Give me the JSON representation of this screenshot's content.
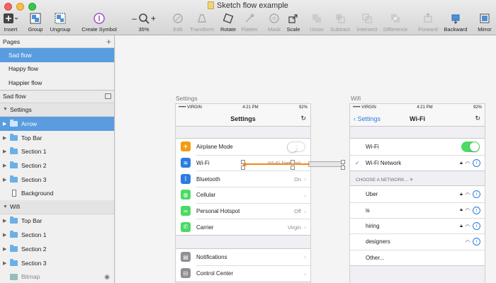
{
  "window": {
    "title": "Sketch flow example"
  },
  "toolbar": {
    "insert": "Insert",
    "group": "Group",
    "ungroup": "Ungroup",
    "create_symbol": "Create Symbol",
    "zoom": "35%",
    "edit": "Edit",
    "transform": "Transform",
    "rotate": "Rotate",
    "flatten": "Flatten",
    "mask": "Mask",
    "scale": "Scale",
    "union": "Union",
    "subtract": "Subtract",
    "intersect": "Intersect",
    "difference": "Difference",
    "forward": "Forward",
    "backward": "Backward",
    "mirror": "Mirror"
  },
  "sidebar": {
    "pages_title": "Pages",
    "pages": [
      {
        "label": "Sad flow",
        "selected": true
      },
      {
        "label": "Happy flow"
      },
      {
        "label": "Happier flow"
      }
    ],
    "current_page": "Sad flow",
    "settings_group": "Settings",
    "settings_layers": [
      "Arrow",
      "Top Bar",
      "Section 1",
      "Section 2",
      "Section 3",
      "Background"
    ],
    "wifi_group": "Wifi",
    "wifi_layers": [
      "Top Bar",
      "Section 1",
      "Section 2",
      "Section 3",
      "Bitmap"
    ]
  },
  "artboards": {
    "settings": {
      "label": "Settings",
      "status": {
        "carrier": "••••• VIRGIN",
        "time": "4:21 PM",
        "battery": "92%"
      },
      "title": "Settings",
      "group1": [
        {
          "label": "Airplane Mode",
          "icon": "airplane-icon",
          "color": "#f39c12"
        },
        {
          "label": "Wi-Fi",
          "value": "Wi-Fi Network",
          "icon": "wifi-icon",
          "color": "#2b7de1"
        },
        {
          "label": "Bluetooth",
          "value": "On",
          "icon": "bluetooth-icon",
          "color": "#2b7de1"
        },
        {
          "label": "Cellular",
          "icon": "cellular-icon",
          "color": "#4cd964"
        },
        {
          "label": "Personal Hotspot",
          "value": "Off",
          "icon": "hotspot-icon",
          "color": "#4cd964"
        },
        {
          "label": "Carrier",
          "value": "Virgin",
          "icon": "phone-icon",
          "color": "#4cd964"
        }
      ],
      "group2": [
        {
          "label": "Notifications",
          "icon": "notifications-icon",
          "color": "#8e8e93"
        },
        {
          "label": "Control Center",
          "icon": "control-center-icon",
          "color": "#8e8e93"
        }
      ]
    },
    "wifi": {
      "label": "Wifi",
      "status": {
        "carrier": "••••• VIRGIN",
        "time": "4:21 PM",
        "battery": "92%"
      },
      "back": "Settings",
      "title": "Wi-Fi",
      "wifi_label": "Wi-Fi",
      "connected": "Wi-Fi Network",
      "choose": "CHOOSE A NETWORK...",
      "networks": [
        {
          "name": "Uber",
          "locked": true
        },
        {
          "name": "is",
          "locked": true
        },
        {
          "name": "hiring",
          "locked": true
        },
        {
          "name": "designers",
          "locked": false
        },
        {
          "name": "Other..."
        }
      ]
    }
  },
  "colors": {
    "accent": "#5a9ce0",
    "flow": "#f08a12",
    "ios_blue": "#2b7de1",
    "ios_green": "#4cd964"
  }
}
